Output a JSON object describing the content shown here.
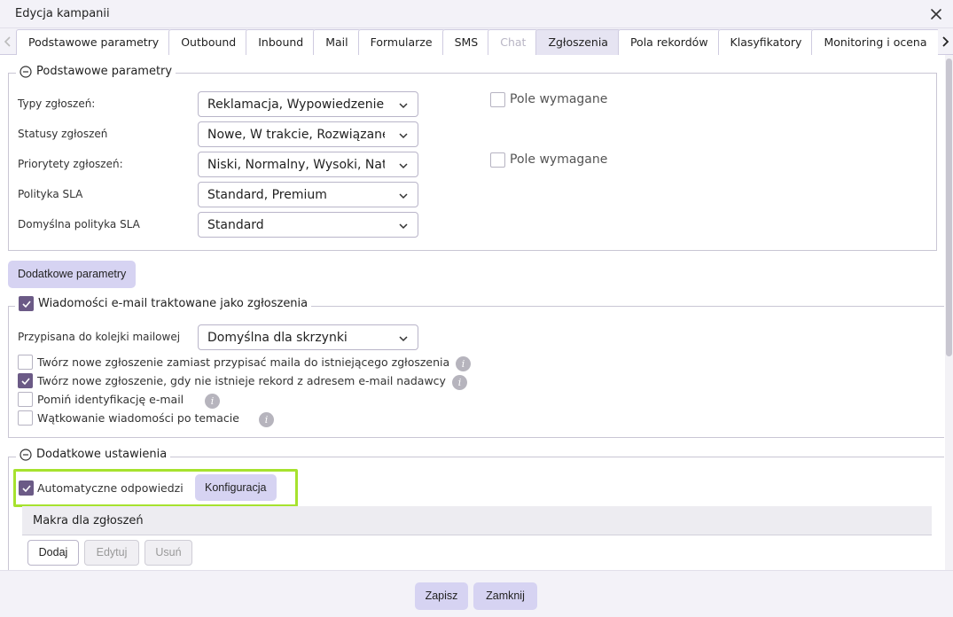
{
  "window": {
    "title": "Edycja kampanii"
  },
  "tabs": [
    {
      "label": "Podstawowe parametry",
      "state": "normal"
    },
    {
      "label": "Outbound",
      "state": "normal"
    },
    {
      "label": "Inbound",
      "state": "normal"
    },
    {
      "label": "Mail",
      "state": "normal"
    },
    {
      "label": "Formularze",
      "state": "normal"
    },
    {
      "label": "SMS",
      "state": "normal"
    },
    {
      "label": "Chat",
      "state": "disabled"
    },
    {
      "label": "Zgłoszenia",
      "state": "active"
    },
    {
      "label": "Pola rekordów",
      "state": "normal"
    },
    {
      "label": "Klasyfikatory",
      "state": "normal"
    },
    {
      "label": "Monitoring i ocena",
      "state": "normal"
    }
  ],
  "basic": {
    "legend": "Podstawowe parametry",
    "ticket_types": {
      "label": "Typy zgłoszeń:",
      "value": "Reklamacja, Wypowiedzenie"
    },
    "ticket_statuses": {
      "label": "Statusy zgłoszeń",
      "value": "Nowe, W trakcie, Rozwiązane"
    },
    "ticket_priorities": {
      "label": "Priorytety zgłoszeń:",
      "value": "Niski, Normalny, Wysoki, Natychmiastowy"
    },
    "sla_policy": {
      "label": "Polityka SLA",
      "value": "Standard, Premium"
    },
    "default_sla": {
      "label": "Domyślna polityka SLA",
      "value": "Standard"
    },
    "required_1": {
      "label": "Pole wymagane",
      "checked": false
    },
    "required_2": {
      "label": "Pole wymagane",
      "checked": false
    }
  },
  "extra_params_button": "Dodatkowe parametry",
  "email": {
    "legend": {
      "label": "Wiadomości e-mail traktowane jako zgłoszenia",
      "checked": true
    },
    "queue": {
      "label": "Przypisana do kolejki mailowej",
      "value": "Domyślna dla skrzynki"
    },
    "options": [
      {
        "label": "Twórz nowe zgłoszenie zamiast przypisać maila do istniejącego zgłoszenia",
        "checked": false
      },
      {
        "label": "Twórz nowe zgłoszenie, gdy nie istnieje rekord z adresem e-mail nadawcy",
        "checked": true
      },
      {
        "label": "Pomiń identyfikację e-mail",
        "checked": false
      },
      {
        "label": "Wątkowanie wiadomości po temacie",
        "checked": false
      }
    ]
  },
  "additional": {
    "legend": "Dodatkowe ustawienia",
    "auto_reply": {
      "label": "Automatyczne odpowiedzi",
      "checked": true
    },
    "config_button": "Konfiguracja",
    "macros": {
      "header": "Makra dla zgłoszeń",
      "add": "Dodaj",
      "edit": "Edytuj",
      "delete": "Usuń"
    }
  },
  "footer": {
    "save": "Zapisz",
    "close": "Zamknij"
  },
  "colors": {
    "accent": "#d6d3f2",
    "checkbox_checked": "#6b5a86",
    "highlight": "#a6e22e"
  }
}
